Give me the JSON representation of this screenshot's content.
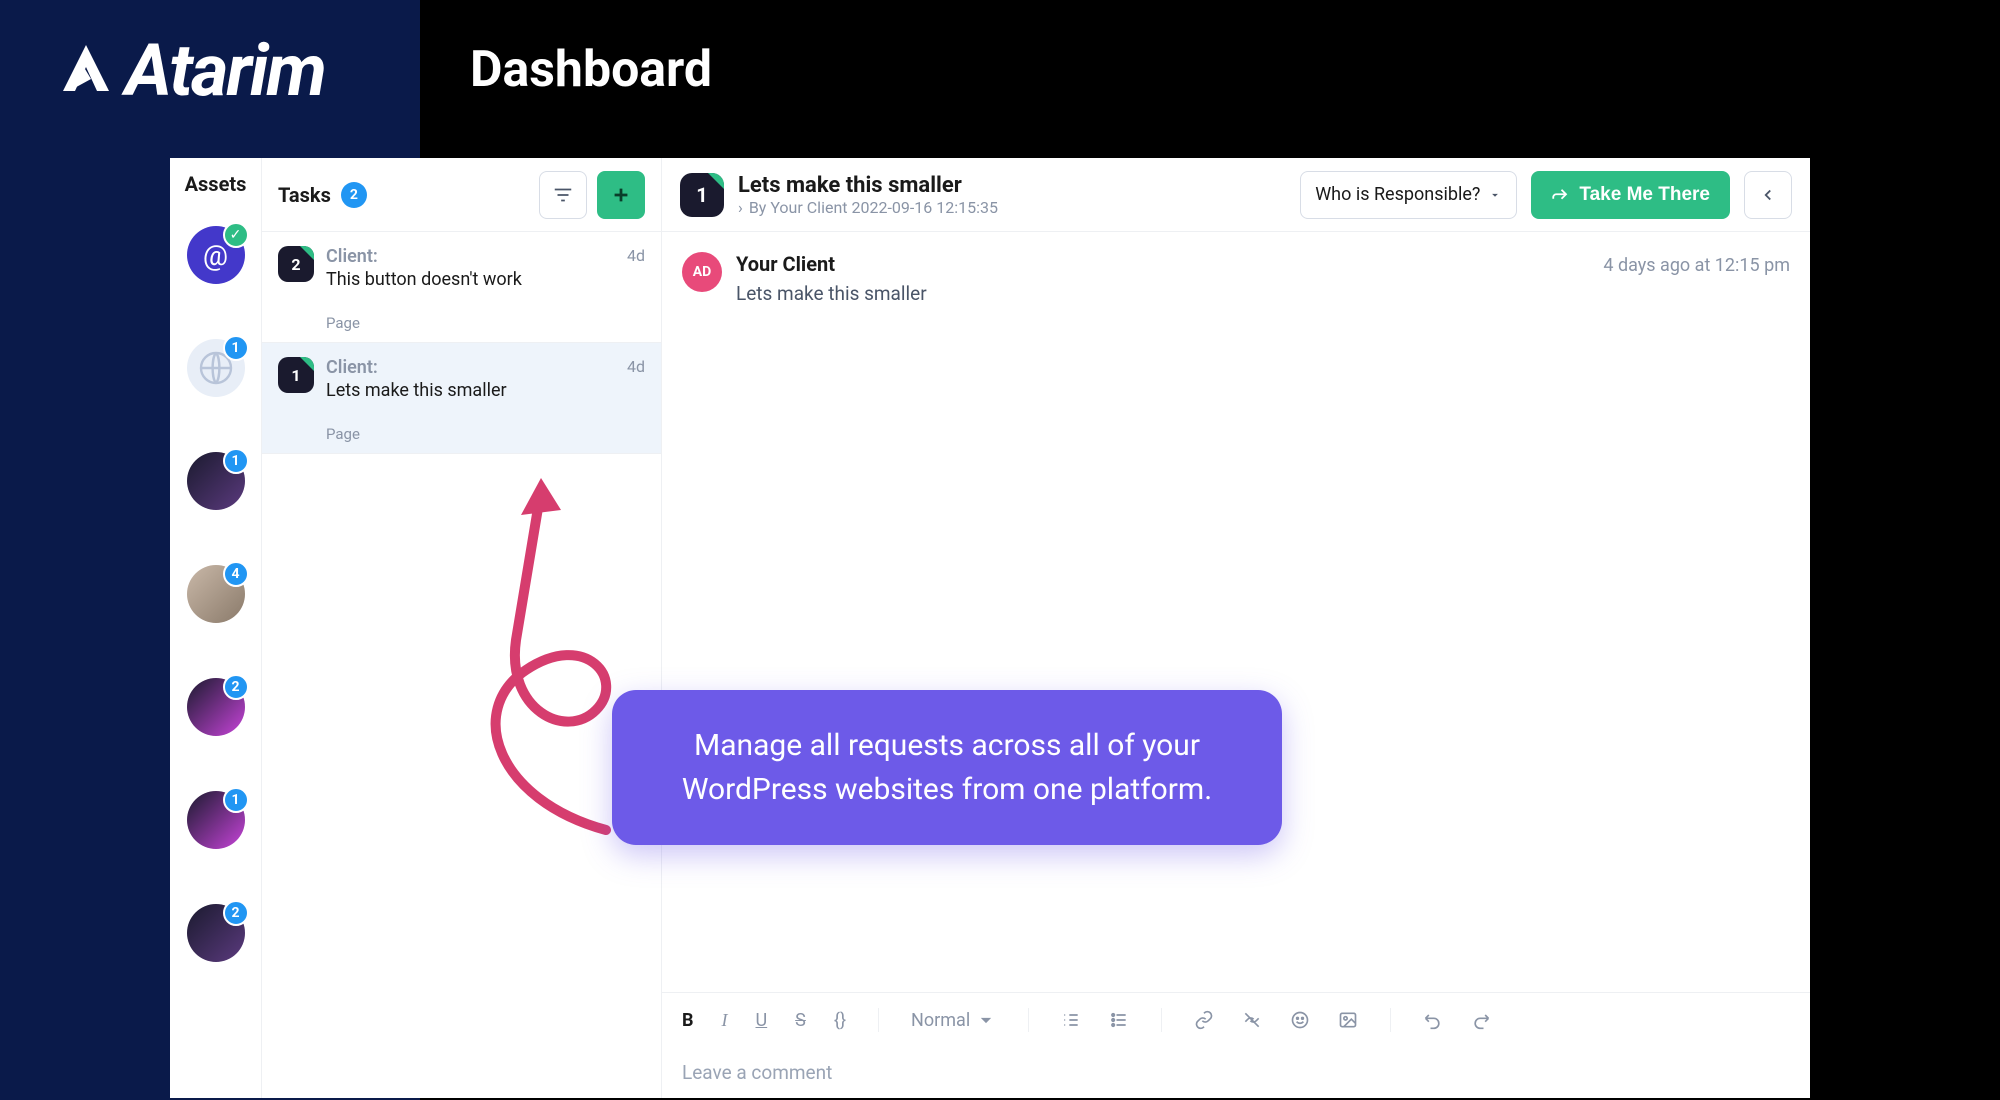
{
  "brand": {
    "name": "Atarim"
  },
  "page": {
    "title": "Dashboard"
  },
  "assets": {
    "header": "Assets",
    "items": [
      {
        "badge_type": "check",
        "badge": ""
      },
      {
        "badge_type": "count",
        "badge": "1"
      },
      {
        "badge_type": "count",
        "badge": "1"
      },
      {
        "badge_type": "count",
        "badge": "4"
      },
      {
        "badge_type": "count",
        "badge": "2"
      },
      {
        "badge_type": "count",
        "badge": "1"
      },
      {
        "badge_type": "count",
        "badge": "2"
      }
    ]
  },
  "tasks": {
    "header": "Tasks",
    "count": "2",
    "items": [
      {
        "num": "2",
        "client": "Client:",
        "title": "This button doesn't work",
        "age": "4d",
        "page": "Page",
        "selected": false
      },
      {
        "num": "1",
        "client": "Client:",
        "title": "Lets make this smaller",
        "age": "4d",
        "page": "Page",
        "selected": true
      }
    ]
  },
  "detail": {
    "num": "1",
    "title": "Lets make this smaller",
    "by_line": "By Your Client 2022-09-16 12:15:35",
    "responsible_label": "Who is Responsible?",
    "take_me_label": "Take Me There"
  },
  "comment": {
    "avatar": "AD",
    "name": "Your Client",
    "time": "4 days ago at 12:15 pm",
    "text": "Lets make this smaller"
  },
  "toolbar": {
    "bold": "B",
    "italic": "I",
    "underline": "U",
    "strike": "S",
    "code": "{}",
    "font_label": "Normal"
  },
  "editor": {
    "placeholder": "Leave a comment"
  },
  "callout": {
    "text": "Manage all requests across all of your WordPress websites from one platform."
  }
}
